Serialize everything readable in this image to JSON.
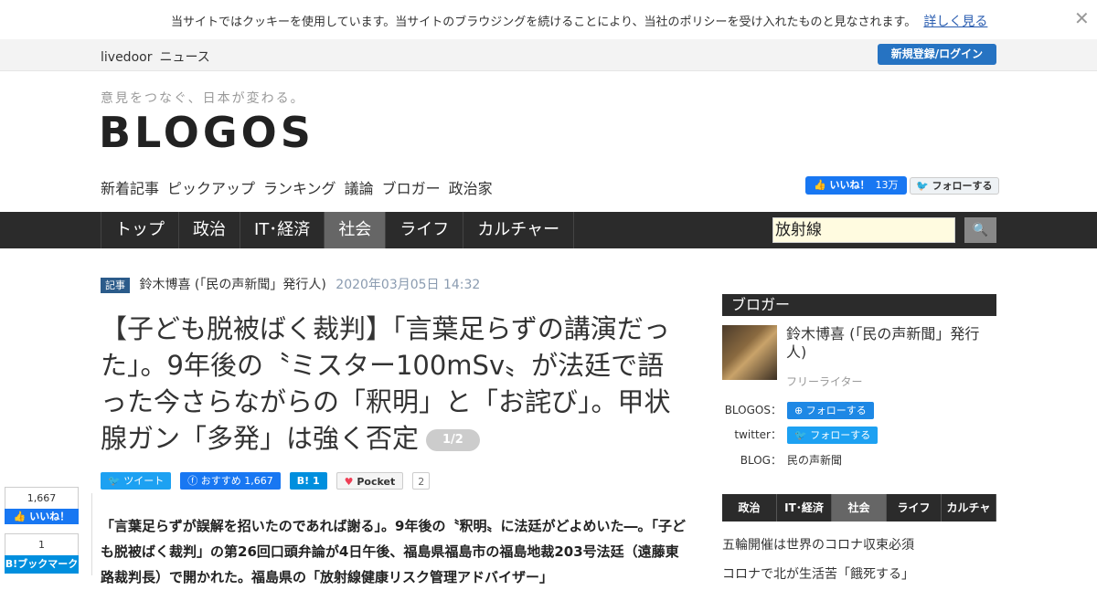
{
  "cookie": {
    "message": "当サイトではクッキーを使用しています。当サイトのブラウジングを続けることにより、当社のポリシーを受け入れたものと見なされます。",
    "more_link": "詳しく見る",
    "close": "✕"
  },
  "topbar": {
    "brand": [
      "livedoor",
      "ニュース"
    ],
    "login": "新規登録/ログイン"
  },
  "header": {
    "tagline": "意見をつなぐ、日本が変わる。",
    "logo": "BLOGOS",
    "subnav": [
      "新着記事",
      "ピックアップ",
      "ランキング",
      "議論",
      "ブロガー",
      "政治家"
    ],
    "fb_like": "いいね！",
    "fb_like_count": "13万",
    "tw_follow": "フォローする"
  },
  "mainnav": {
    "tabs": [
      "トップ",
      "政治",
      "IT･経済",
      "社会",
      "ライフ",
      "カルチャー"
    ],
    "active": "社会",
    "search_value": "放射線",
    "search_icon": "search-icon"
  },
  "article": {
    "badge": "記事",
    "author": "鈴木博喜 (「民の声新聞」発行人)",
    "date": "2020年03月05日 14:32",
    "title": "【子ども脱被ばく裁判】「言葉足らずの講演だった」。9年後の〝ミスター100mSv〟が法廷で語った今さらながらの「釈明」と「お詫び」。甲状腺ガン「多発」は強く否定",
    "page": "1/2",
    "share": {
      "tweet": "ツイート",
      "fb": "おすすめ",
      "fb_count": "1,667",
      "hatena": "B!",
      "hatena_count": "1",
      "pocket": "Pocket",
      "pocket_count": "2"
    },
    "lead": "「言葉足らずが誤解を招いたのであれば謝る」。9年後の〝釈明〟に法廷がどよめいた―。「子ども脱被ばく裁判」の第26回口頭弁論が4日午後、福島県福島市の福島地裁203号法廷（遠藤東路裁判長）で開かれた。福島県の「放射線健康リスク管理アドバイザー」"
  },
  "floating": {
    "fb_count": "1,667",
    "fb_label": "いいね！",
    "hb_count": "1",
    "hb_label": "B!ブックマーク"
  },
  "sidebar": {
    "heading": "ブロガー",
    "blogger_name": "鈴木博喜 (「民の声新聞」発行人)",
    "blogger_role": "フリーライター",
    "rows": [
      {
        "key": "BLOGOS：",
        "value": "フォローする"
      },
      {
        "key": "twitter：",
        "value": "フォローする"
      },
      {
        "key": "BLOG：",
        "value": "民の声新聞"
      }
    ],
    "cats": [
      "政治",
      "IT･経済",
      "社会",
      "ライフ",
      "カルチャー"
    ],
    "cat_active": "社会",
    "news": [
      "五輪開催は世界のコロナ収束必須",
      "コロナで北が生活苦「餓死する」"
    ]
  }
}
